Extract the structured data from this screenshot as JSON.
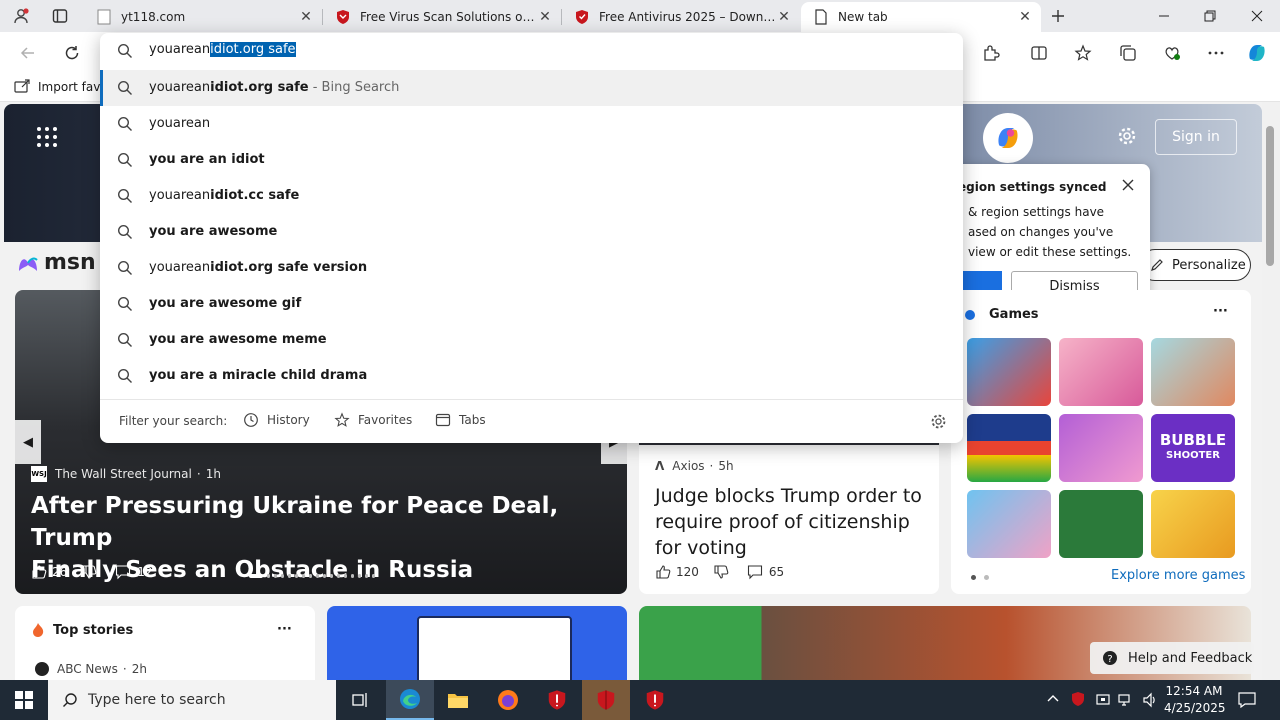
{
  "tabs": [
    {
      "title": "yt118.com",
      "icon": "blank-page-icon"
    },
    {
      "title": "Free Virus Scan Solutions of 2025",
      "icon": "red-shield-icon"
    },
    {
      "title": "Free Antivirus 2025 – Download Free",
      "icon": "red-shield-icon"
    },
    {
      "title": "New tab",
      "icon": "new-tab-page-icon"
    }
  ],
  "address": {
    "typed": "youarean",
    "autocomplete": "idiot.org safe"
  },
  "suggestions": [
    {
      "plain": "youarean",
      "bold": "idiot.org safe",
      "suffix": " - Bing Search"
    },
    {
      "plain": "youarean",
      "bold": "",
      "suffix": ""
    },
    {
      "plain": "",
      "bold": "you are an idiot",
      "suffix": ""
    },
    {
      "plain": "youarean",
      "bold": "idiot.cc safe",
      "suffix": ""
    },
    {
      "plain": "",
      "bold": "you are awesome",
      "suffix": ""
    },
    {
      "plain": "youarean",
      "bold": "idiot.org safe version",
      "suffix": ""
    },
    {
      "plain": "",
      "bold": "you are awesome gif",
      "suffix": ""
    },
    {
      "plain": "",
      "bold": "you are awesome meme",
      "suffix": ""
    },
    {
      "plain": "",
      "bold": "you are a miracle child drama",
      "suffix": ""
    }
  ],
  "filter": {
    "label": "Filter your search:",
    "history": "History",
    "favorites": "Favorites",
    "tabs": "Tabs"
  },
  "favbar": {
    "import": "Import favo"
  },
  "msn": {
    "logo": "msn",
    "sign_in": "Sign in",
    "personalize": "Personalize"
  },
  "sync_popup": {
    "title": "egion settings synced",
    "body1": "& region settings have",
    "body2": "ased on changes you've",
    "body3": "view or edit these settings.",
    "dismiss": "Dismiss"
  },
  "hero": {
    "source": "The Wall Street Journal",
    "age": "1h",
    "headline1": "After Pressuring Ukraine for Peace Deal, Trump",
    "headline2": "Finally Sees an Obstacle in Russia",
    "likes": "26",
    "comments": "12"
  },
  "axios": {
    "source": "Axios",
    "age": "5h",
    "headline1": "Judge blocks Trump order to",
    "headline2": "require proof of citizenship",
    "headline3": "for voting",
    "likes": "120",
    "comments": "65"
  },
  "games": {
    "title": "Games",
    "explore": "Explore more games",
    "bubble_line1": "BUBBLE",
    "bubble_line2": "SHOOTER"
  },
  "top_stories": {
    "title": "Top stories",
    "first_source": "ABC News",
    "first_age": "2h"
  },
  "help": {
    "label": "Help and Feedback"
  },
  "taskbar": {
    "search_placeholder": "Type here to search",
    "time": "12:54 AM",
    "date": "4/25/2025"
  },
  "colors": {
    "accent": "#0f6cbd",
    "selection": "#0063b1",
    "taskbar": "#1f2a36",
    "shield": "#c8171e"
  }
}
